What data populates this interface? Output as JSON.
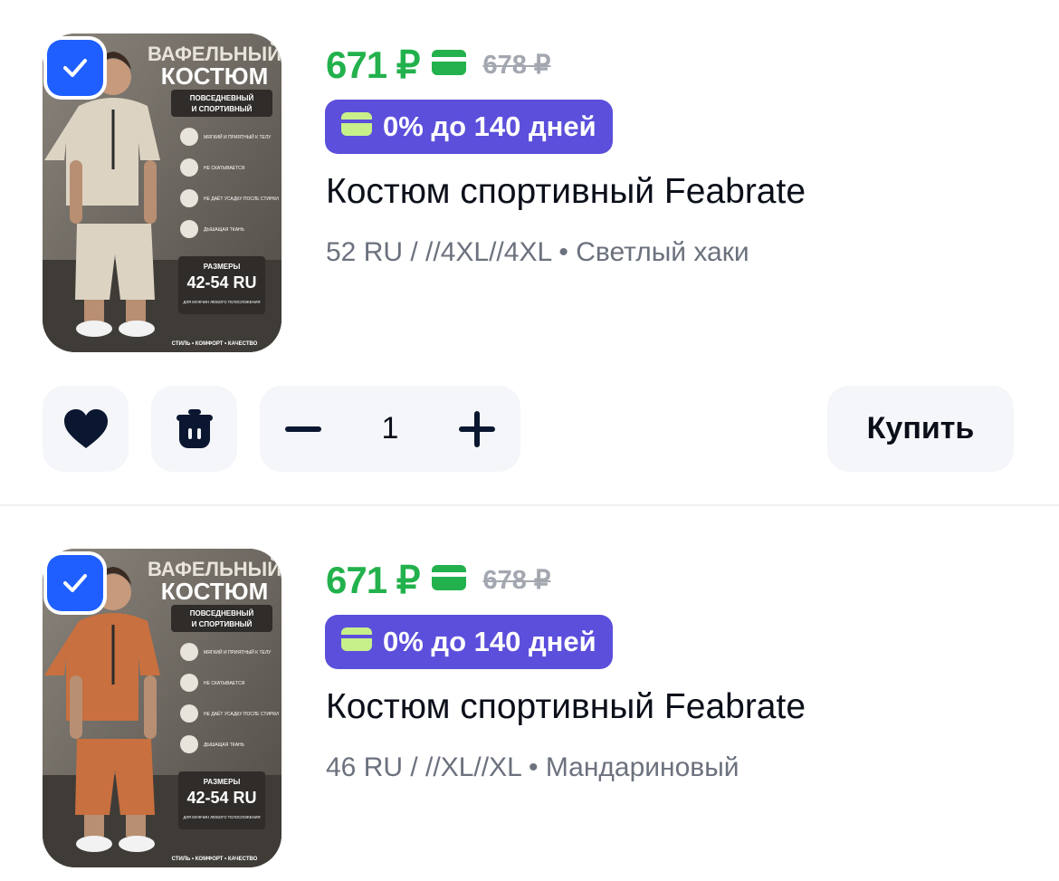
{
  "items": [
    {
      "selected": true,
      "price": "671 ₽",
      "old_price": "678 ₽",
      "installment": "0% до 140 дней",
      "title": "Костюм спортивный Feabrate",
      "variant": "52 RU / //4XL//4XL • Светлый хаки",
      "quantity": "1",
      "buy_label": "Купить",
      "image": {
        "headline_1": "ВАФЕЛЬНЫЙ",
        "headline_2": "КОСТЮМ",
        "subtitle_1": "ПОВСЕДНЕВНЫЙ",
        "subtitle_2": "И СПОРТИВНЫЙ",
        "feature_1": "МЯГКИЙ И ПРИЯТНЫЙ К ТЕЛУ",
        "feature_2": "НЕ СКАТЫВАЕТСЯ",
        "feature_3": "НЕ ДАЁТ УСАДКУ ПОСЛЕ СТИРКИ",
        "feature_4": "ДЫШАЩАЯ ТКАНЬ",
        "size_label": "РАЗМЕРЫ",
        "size_range": "42-54 RU",
        "size_note": "ДЛЯ МУЖЧИН ЛЮБОГО ТЕЛОСЛОЖЕНИЯ",
        "footer": "СТИЛЬ • КОМФОРТ • КАЧЕСТВО",
        "outfit_color": "#dcd3c3"
      }
    },
    {
      "selected": true,
      "price": "671 ₽",
      "old_price": "678 ₽",
      "installment": "0% до 140 дней",
      "title": "Костюм спортивный Feabrate",
      "variant": "46 RU / //XL//XL • Мандариновый",
      "image": {
        "headline_1": "ВАФЕЛЬНЫЙ",
        "headline_2": "КОСТЮМ",
        "subtitle_1": "ПОВСЕДНЕВНЫЙ",
        "subtitle_2": "И СПОРТИВНЫЙ",
        "feature_1": "МЯГКИЙ И ПРИЯТНЫЙ К ТЕЛУ",
        "feature_2": "НЕ СКАТЫВАЕТСЯ",
        "feature_3": "НЕ ДАЁТ УСАДКУ ПОСЛЕ СТИРКИ",
        "feature_4": "ДЫШАЩАЯ ТКАНЬ",
        "size_label": "РАЗМЕРЫ",
        "size_range": "42-54 RU",
        "size_note": "ДЛЯ МУЖЧИН ЛЮБОГО ТЕЛОСЛОЖЕНИЯ",
        "footer": "СТИЛЬ • КОМФОРТ • КАЧЕСТВО",
        "outfit_color": "#c8703f"
      }
    }
  ],
  "icons": {
    "favorite": "heart-icon",
    "delete": "trash-icon",
    "decrease": "minus-icon",
    "increase": "plus-icon",
    "selected": "checkmark-icon",
    "card": "card-icon"
  },
  "colors": {
    "price_green": "#22b14c",
    "bnpl_purple": "#5b4fdb",
    "check_blue": "#1f5fff",
    "button_bg": "#f4f6f9"
  }
}
